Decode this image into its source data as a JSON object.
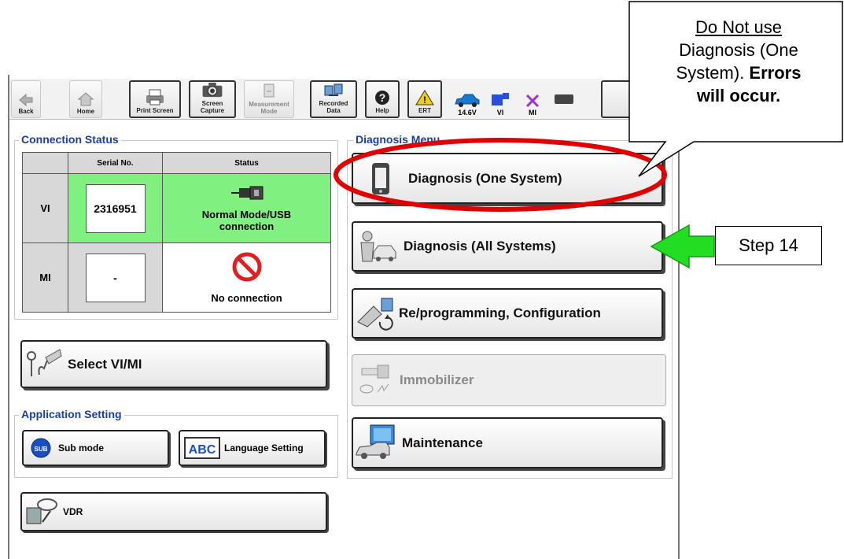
{
  "toolbar": {
    "back": "Back",
    "home": "Home",
    "print_screen": "Print Screen",
    "screen_capture": "Screen\nCapture",
    "measurement_mode": "Measurement\nMode",
    "recorded_data": "Recorded\nData",
    "help": "Help",
    "ert": "ERT",
    "voltage": "14.6V",
    "vi": "VI",
    "mi": "MI"
  },
  "connection_status": {
    "title": "Connection Status",
    "col_serial": "Serial No.",
    "col_status": "Status",
    "rows": [
      {
        "label": "VI",
        "serial": "2316951",
        "status": "Normal Mode/USB connection",
        "status_color": "#80f080"
      },
      {
        "label": "MI",
        "serial": "-",
        "status": "No connection",
        "status_color": "#ffffff"
      }
    ]
  },
  "select_vimi": "Select VI/MI",
  "application_setting": {
    "title": "Application Setting",
    "sub_mode": "Sub mode",
    "language_setting": "Language Setting"
  },
  "vdr": "VDR",
  "diagnosis_menu": {
    "title": "Diagnosis Menu",
    "items": [
      {
        "label": "Diagnosis (One System)",
        "icon": "phone-device-icon"
      },
      {
        "label": "Diagnosis (All Systems)",
        "icon": "technician-car-icon"
      },
      {
        "label": "Re/programming, Configuration",
        "icon": "reprogramming-icon"
      },
      {
        "label": "Immobilizer",
        "icon": "key-icon",
        "disabled": true
      },
      {
        "label": "Maintenance",
        "icon": "car-monitor-icon"
      }
    ]
  },
  "annotation": {
    "callout_line1": "Do Not use",
    "callout_line2": "Diagnosis (One",
    "callout_line3a": "System). ",
    "callout_line3b": "Errors",
    "callout_line4": "will occur.",
    "step": "Step 14",
    "circle_color": "#e00000",
    "arrow_color": "#22dd22"
  }
}
